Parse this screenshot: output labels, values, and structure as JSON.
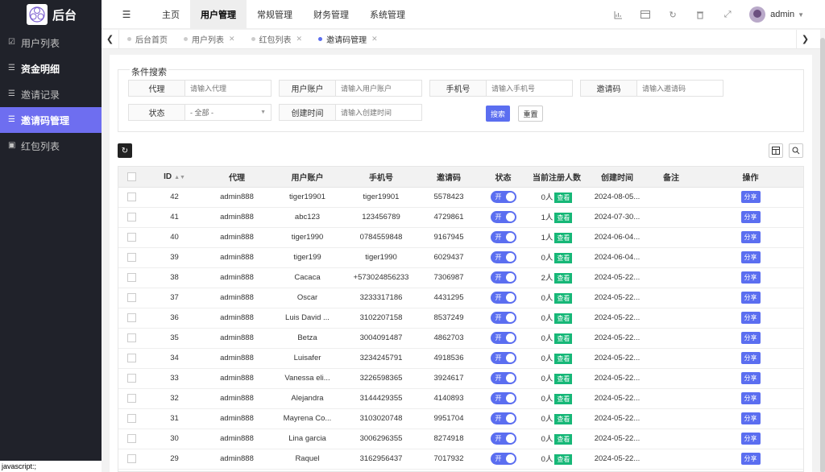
{
  "app": {
    "title": "后台",
    "collapse_icon": "menu-collapse-icon"
  },
  "sidebar": {
    "items": [
      {
        "label": "用户列表",
        "icon": "users-icon"
      },
      {
        "label": "资金明细",
        "icon": "list-icon"
      },
      {
        "label": "邀请记录",
        "icon": "list-icon"
      },
      {
        "label": "邀请码管理",
        "icon": "list-icon"
      },
      {
        "label": "红包列表",
        "icon": "gift-icon"
      }
    ],
    "status_text": "javascript:;"
  },
  "topnav": {
    "items": [
      "主页",
      "用户管理",
      "常规管理",
      "财务管理",
      "系统管理"
    ],
    "active": "用户管理",
    "user": "admin"
  },
  "tabs": {
    "items": [
      "后台首页",
      "用户列表",
      "红包列表",
      "邀请码管理"
    ],
    "active": "邀请码管理"
  },
  "search": {
    "title": "条件搜索",
    "fields": [
      {
        "label": "代理",
        "placeholder": "请输入代理"
      },
      {
        "label": "用户账户",
        "placeholder": "请输入用户账户"
      },
      {
        "label": "手机号",
        "placeholder": "请输入手机号"
      },
      {
        "label": "邀请码",
        "placeholder": "请输入邀请码"
      },
      {
        "label": "状态",
        "value": "- 全部 -"
      },
      {
        "label": "创建时间",
        "placeholder": "请输入创建时间"
      }
    ],
    "search_label": "搜索",
    "reset_label": "重置"
  },
  "table": {
    "headers": [
      "ID",
      "代理",
      "用户账户",
      "手机号",
      "邀请码",
      "状态",
      "当前注册人数",
      "创建时间",
      "备注",
      "操作"
    ],
    "switch_label": "开",
    "view_label": "查看",
    "share_label": "分享",
    "rows": [
      {
        "id": "42",
        "agent": "admin888",
        "account": "tiger19901",
        "phone": "tiger19901",
        "code": "5578423",
        "count": "0人",
        "created": "2024-08-05...",
        "note": ""
      },
      {
        "id": "41",
        "agent": "admin888",
        "account": "abc123",
        "phone": "123456789",
        "code": "4729861",
        "count": "1人",
        "created": "2024-07-30...",
        "note": ""
      },
      {
        "id": "40",
        "agent": "admin888",
        "account": "tiger1990",
        "phone": "0784559848",
        "code": "9167945",
        "count": "1人",
        "created": "2024-06-04...",
        "note": ""
      },
      {
        "id": "39",
        "agent": "admin888",
        "account": "tiger199",
        "phone": "tiger1990",
        "code": "6029437",
        "count": "0人",
        "created": "2024-06-04...",
        "note": ""
      },
      {
        "id": "38",
        "agent": "admin888",
        "account": "Cacaca",
        "phone": "+573024856233",
        "code": "7306987",
        "count": "2人",
        "created": "2024-05-22...",
        "note": ""
      },
      {
        "id": "37",
        "agent": "admin888",
        "account": "Oscar",
        "phone": "3233317186",
        "code": "4431295",
        "count": "0人",
        "created": "2024-05-22...",
        "note": ""
      },
      {
        "id": "36",
        "agent": "admin888",
        "account": "Luis David ...",
        "phone": "3102207158",
        "code": "8537249",
        "count": "0人",
        "created": "2024-05-22...",
        "note": ""
      },
      {
        "id": "35",
        "agent": "admin888",
        "account": "Betza",
        "phone": "3004091487",
        "code": "4862703",
        "count": "0人",
        "created": "2024-05-22...",
        "note": ""
      },
      {
        "id": "34",
        "agent": "admin888",
        "account": "Luisafer",
        "phone": "3234245791",
        "code": "4918536",
        "count": "0人",
        "created": "2024-05-22...",
        "note": ""
      },
      {
        "id": "33",
        "agent": "admin888",
        "account": "Vanessa eli...",
        "phone": "3226598365",
        "code": "3924617",
        "count": "0人",
        "created": "2024-05-22...",
        "note": ""
      },
      {
        "id": "32",
        "agent": "admin888",
        "account": "Alejandra",
        "phone": "3144429355",
        "code": "4140893",
        "count": "0人",
        "created": "2024-05-22...",
        "note": ""
      },
      {
        "id": "31",
        "agent": "admin888",
        "account": "Mayrena Co...",
        "phone": "3103020748",
        "code": "9951704",
        "count": "0人",
        "created": "2024-05-22...",
        "note": ""
      },
      {
        "id": "30",
        "agent": "admin888",
        "account": "Lina garcia",
        "phone": "3006296355",
        "code": "8274918",
        "count": "0人",
        "created": "2024-05-22...",
        "note": ""
      },
      {
        "id": "29",
        "agent": "admin888",
        "account": "Raquel",
        "phone": "3162956437",
        "code": "7017932",
        "count": "0人",
        "created": "2024-05-22...",
        "note": ""
      }
    ]
  },
  "colors": {
    "accent": "#5b6ef0",
    "sidebar_bg": "#20222a",
    "view_green": "#16b777"
  }
}
